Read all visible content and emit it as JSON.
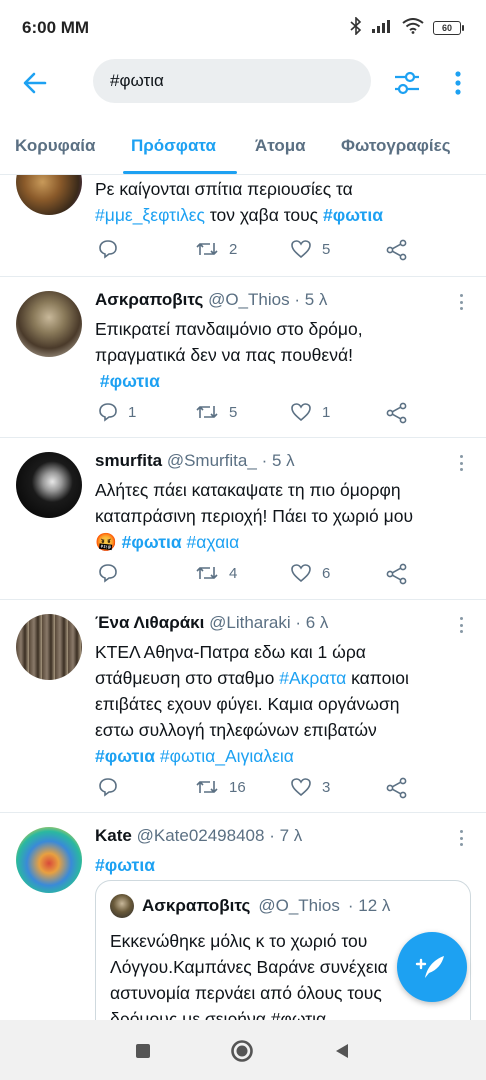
{
  "status_bar": {
    "time": "6:00 MM",
    "battery": "60"
  },
  "search": {
    "query": "#φωτια"
  },
  "tabs": [
    {
      "label": "Κορυφαία"
    },
    {
      "label": "Πρόσφατα"
    },
    {
      "label": "Άτομα"
    },
    {
      "label": "Φωτογραφίες"
    }
  ],
  "tweets": [
    {
      "line1": "Ρε  καίγονται σπίτια περιουσίες τα",
      "hashtag_a": "#μμε_ξεφτιλες",
      "text_mid": " τον χαβα τους ",
      "hashtag_b": "#φωτια",
      "retweets": "2",
      "likes": "5"
    },
    {
      "name": "Ασκραποβιτς",
      "handle": "@O_Thios",
      "time": "· 5 λ",
      "line1": "Επικρατεί πανδαιμόνιο στο δρόμο,",
      "line2": "πραγματικά δεν να πας πουθενά!",
      "hashtag": "#φωτια",
      "replies": "1",
      "retweets": "5",
      "likes": "1"
    },
    {
      "name": "smurfita",
      "handle": "@Smurfita_",
      "time": "· 5 λ",
      "line1": "Αλήτες πάει κατακαψατε τη πιο όμορφη",
      "line2": "καταπράσινη περιοχή! Πάει το χωριό μου",
      "emoji": "🤬",
      "hashtag_a": "#φωτια",
      "hashtag_b": "#αχαια",
      "retweets": "4",
      "likes": "6"
    },
    {
      "name": "Ένα Λιθαράκι",
      "handle": "@Litharaki",
      "time": "· 6 λ",
      "line1": "ΚΤΕΛ Αθηνα-Πατρα εδω και 1 ώρα",
      "line2a": "στάθμευση στο σταθμο ",
      "hashtag_inline": "#Ακρατα",
      "line2b": " καποιοι",
      "line3": "επιβάτες εχουν φύγει. Καμια οργάνωση",
      "line4": "εστω συλλογή τηλεφώνων επιβατών",
      "hashtag_a": "#φωτια",
      "hashtag_b": "#φωτια_Αιγιαλεια",
      "retweets": "16",
      "likes": "3"
    },
    {
      "name": "Kate",
      "handle": "@Kate02498408",
      "time": "· 7 λ",
      "hashtag": "#φωτια",
      "quote": {
        "name": "Ασκραποβιτς",
        "handle": "@O_Thios",
        "time": "· 12 λ",
        "line1": "Εκκενώθηκε μόλις κ το χωριό του",
        "line2": "Λόγγου.Καμπάνες Βαράνε συνέχεια",
        "line3": "αστυνομία περνάει από όλους τους",
        "line4": "δρόμους με σειρήνα  #φωτια"
      }
    }
  ],
  "icons": {
    "back": "back-arrow-icon",
    "filter": "sliders-icon",
    "overflow": "more-vertical-icon",
    "reply": "reply-icon",
    "retweet": "retweet-icon",
    "like": "heart-icon",
    "share": "share-icon",
    "compose": "compose-tweet-icon"
  },
  "colors": {
    "accent": "#1da1f2",
    "secondary_text": "#5b7083",
    "primary_text": "#0f1419"
  }
}
